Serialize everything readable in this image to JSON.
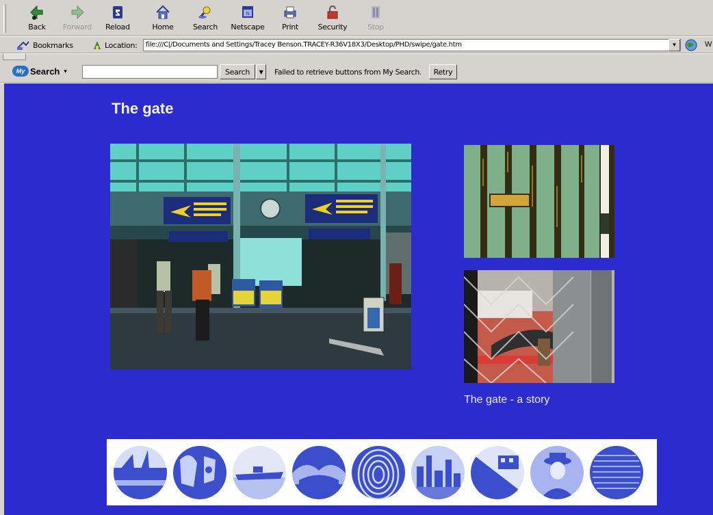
{
  "toolbar": {
    "buttons": [
      {
        "label": "Back",
        "icon": "back-arrow-icon"
      },
      {
        "label": "Forward",
        "icon": "forward-arrow-icon",
        "disabled": true
      },
      {
        "label": "Reload",
        "icon": "reload-icon"
      },
      {
        "label": "Home",
        "icon": "home-icon"
      },
      {
        "label": "Search",
        "icon": "search-icon"
      },
      {
        "label": "Netscape",
        "icon": "netscape-icon"
      },
      {
        "label": "Print",
        "icon": "print-icon"
      },
      {
        "label": "Security",
        "icon": "security-lock-icon"
      },
      {
        "label": "Stop",
        "icon": "stop-icon",
        "disabled": true
      }
    ]
  },
  "location_bar": {
    "bookmarks_label": "Bookmarks",
    "location_label": "Location:",
    "url": "file:///C|/Documents and Settings/Tracey Benson.TRACEY-R36V18X3/Desktop/PHD/swipe/gate.htm",
    "trailing_text": "W"
  },
  "my_search": {
    "logo_badge": "My",
    "logo_word": "Search",
    "input_value": "",
    "search_button": "Search",
    "message": "Failed to retrieve buttons from My Search.",
    "retry_button": "Retry"
  },
  "content": {
    "title": "The gate",
    "story_link": "The gate - a story",
    "background_color": "#2b2bcf"
  }
}
